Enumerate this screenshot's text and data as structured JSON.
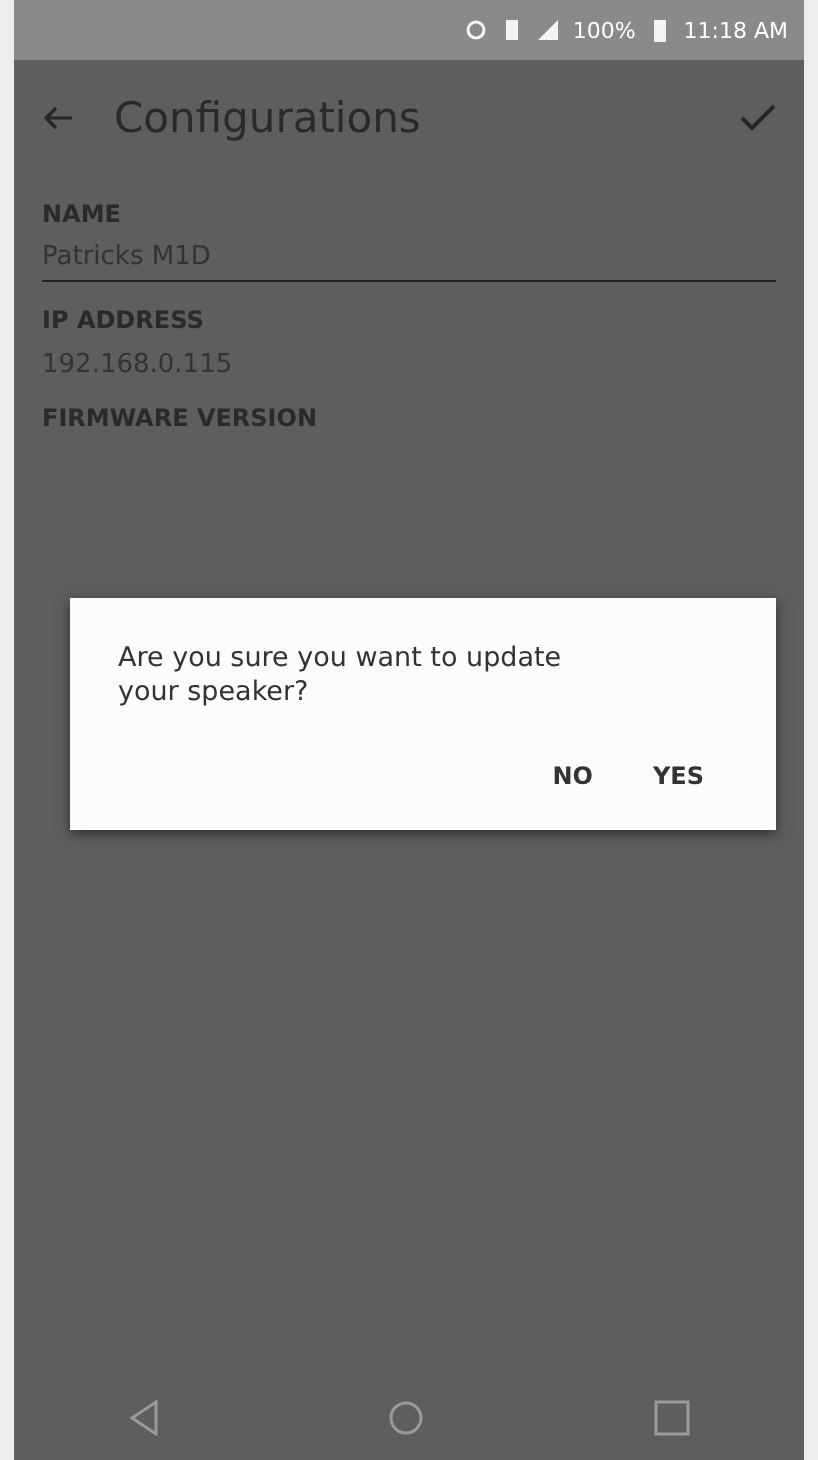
{
  "status_bar": {
    "battery": "100%",
    "time": "11:18 AM"
  },
  "app_bar": {
    "title": "Configurations"
  },
  "fields": [
    {
      "kind": "input",
      "label": "NAME",
      "value": "Patricks M1D"
    },
    {
      "kind": "text",
      "label": "IP ADDRESS",
      "value": "192.168.0.115"
    },
    {
      "kind": "text",
      "label": "FIRMWARE VERSION"
    }
  ],
  "dialog": {
    "message": "Are you sure you want to update your speaker?",
    "buttons": [
      "NO",
      "YES"
    ]
  }
}
